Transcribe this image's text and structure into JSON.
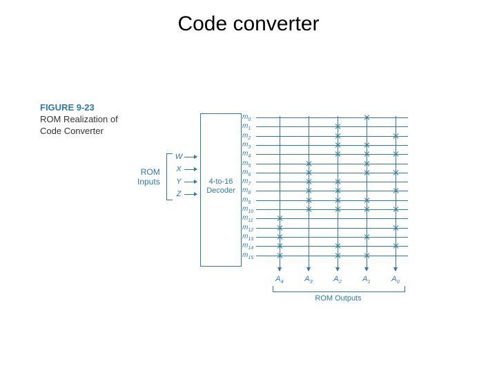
{
  "title": "Code converter",
  "figure": {
    "number": "FIGURE 9-23",
    "caption_l1": "ROM Realization of",
    "caption_l2": "Code Converter"
  },
  "rom_inputs_label_l1": "ROM",
  "rom_inputs_label_l2": "Inputs",
  "inputs": [
    "W",
    "X",
    "Y",
    "Z"
  ],
  "decoder_l1": "4-to-16",
  "decoder_l2": "Decoder",
  "m_prefix": "m",
  "rom_outputs_label": "ROM Outputs",
  "output_prefix": "A",
  "outputs": [
    "4",
    "3",
    "2",
    "1",
    "0"
  ],
  "chart_data": {
    "type": "table",
    "description": "ROM programming matrix: rows are decoder minterm lines m0..m15, columns are output lines A4..A0. 'x' indicates a programmed connection (output asserted for that minterm).",
    "rows": [
      "m0",
      "m1",
      "m2",
      "m3",
      "m4",
      "m5",
      "m6",
      "m7",
      "m8",
      "m9",
      "m10",
      "m11",
      "m12",
      "m13",
      "m14",
      "m15"
    ],
    "columns": [
      "A4",
      "A3",
      "A2",
      "A1",
      "A0"
    ],
    "cells": [
      [
        0,
        0,
        0,
        1,
        0
      ],
      [
        0,
        0,
        1,
        0,
        0
      ],
      [
        0,
        0,
        1,
        0,
        1
      ],
      [
        0,
        0,
        1,
        1,
        0
      ],
      [
        0,
        0,
        1,
        1,
        1
      ],
      [
        0,
        1,
        0,
        1,
        0
      ],
      [
        0,
        1,
        0,
        1,
        1
      ],
      [
        0,
        1,
        1,
        0,
        0
      ],
      [
        0,
        1,
        1,
        0,
        1
      ],
      [
        0,
        1,
        1,
        1,
        0
      ],
      [
        0,
        1,
        1,
        1,
        1
      ],
      [
        1,
        0,
        0,
        0,
        0
      ],
      [
        1,
        0,
        0,
        0,
        1
      ],
      [
        1,
        0,
        0,
        1,
        0
      ],
      [
        1,
        0,
        1,
        0,
        1
      ],
      [
        1,
        0,
        1,
        1,
        0
      ]
    ]
  }
}
